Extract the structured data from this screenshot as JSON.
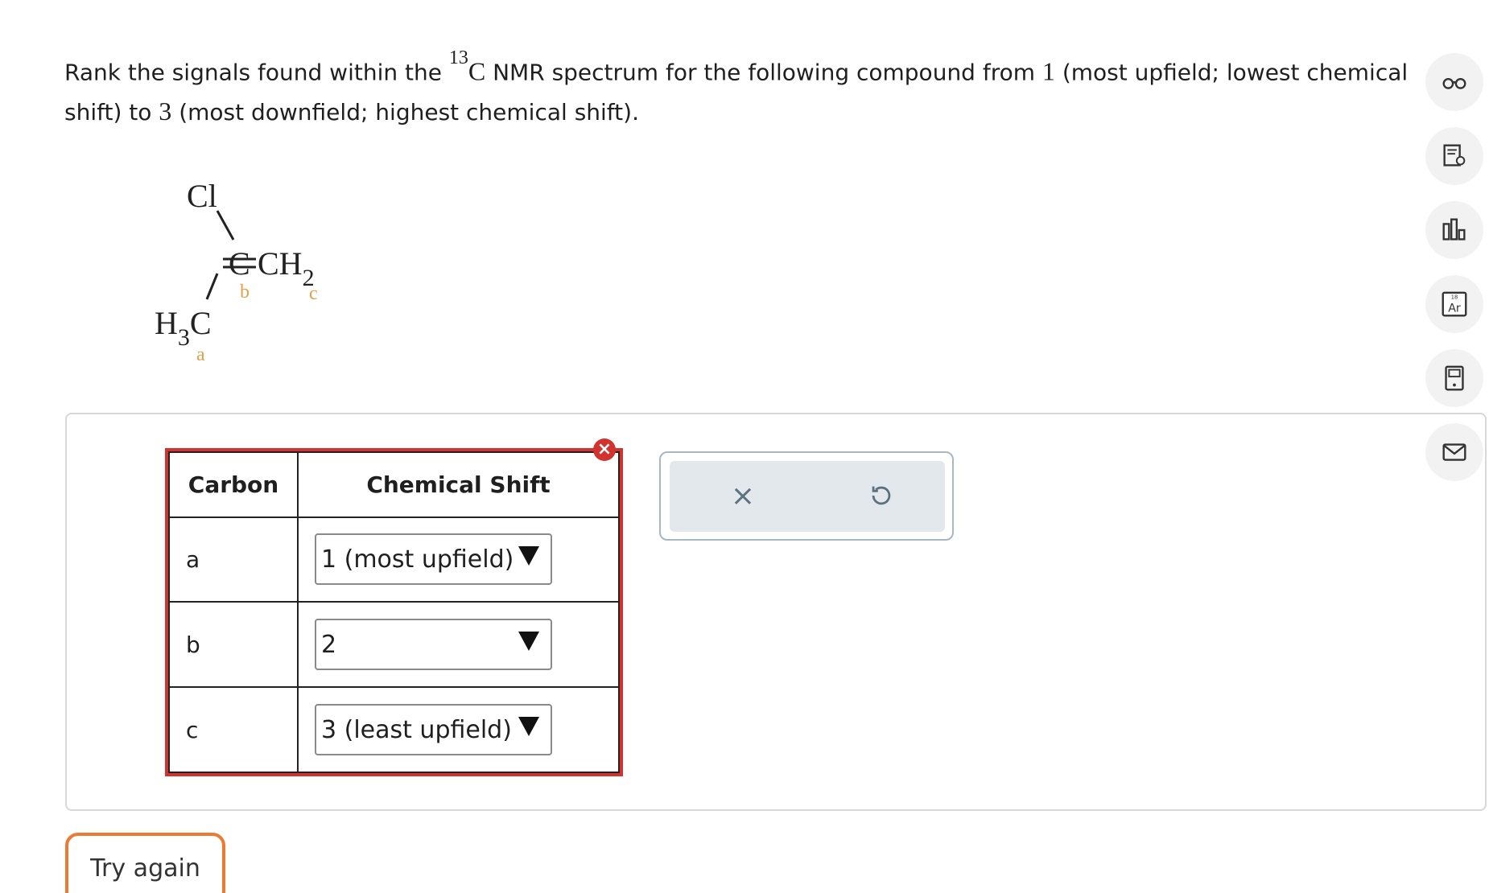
{
  "question": {
    "part1": "Rank the signals found within the ",
    "isotope": "13",
    "part2": "C",
    "part3": " NMR spectrum for the following compound from ",
    "num1": "1",
    "part4": " (most upfield; lowest chemical shift) to ",
    "num2": "3",
    "part5": " (most downfield; highest chemical shift)."
  },
  "molecule": {
    "cl": "Cl",
    "c": "C",
    "double_bond": "═",
    "ch": "CH",
    "ch_sub": "2",
    "h": "H",
    "h_sub": "3",
    "c2": "C",
    "label_a": "a",
    "label_b": "b",
    "label_c": "c"
  },
  "table": {
    "header_carbon": "Carbon",
    "header_shift": "Chemical Shift",
    "rows": [
      {
        "carbon": "a",
        "shift": "1 (most upfield)"
      },
      {
        "carbon": "b",
        "shift": "2"
      },
      {
        "carbon": "c",
        "shift": "3 (least upfield)"
      }
    ]
  },
  "actions": {
    "clear_icon": "×",
    "undo_icon": "undo-icon"
  },
  "error_badge": "×",
  "try_again": "Try again",
  "rail_icons": [
    "glasses-icon",
    "notes-bulb-icon",
    "chart-icon",
    "periodic-table-icon",
    "calculator-icon",
    "mail-icon"
  ],
  "periodic": {
    "num": "18",
    "symbol": "Ar"
  },
  "colors": {
    "accent_orange": "#ec7a32",
    "error_red": "#d2332e",
    "label_orange": "#e6a04a"
  }
}
